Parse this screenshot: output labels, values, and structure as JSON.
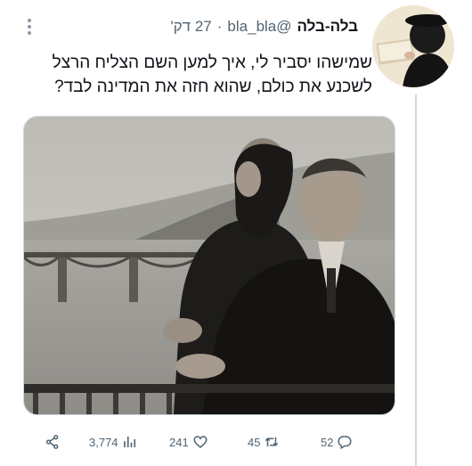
{
  "tweet": {
    "display_name": "בלה-בלה",
    "handle": "@bla_bla",
    "separator": "·",
    "time": "27 דק'",
    "text_line1": "שמישהו יסביר לי, איך למען השם הצליח הרצל",
    "text_line2": "לשכנע את כולם, שהוא חזה את המדינה לבד?"
  },
  "actions": {
    "views": "3,774",
    "likes": "241",
    "retweets": "45",
    "replies": "52"
  },
  "icons": [
    "more-icon",
    "share-icon",
    "views-icon",
    "like-icon",
    "retweet-icon",
    "reply-icon"
  ],
  "colors": {
    "text": "#0f1419",
    "secondary": "#536471",
    "border": "#cfd9de"
  }
}
